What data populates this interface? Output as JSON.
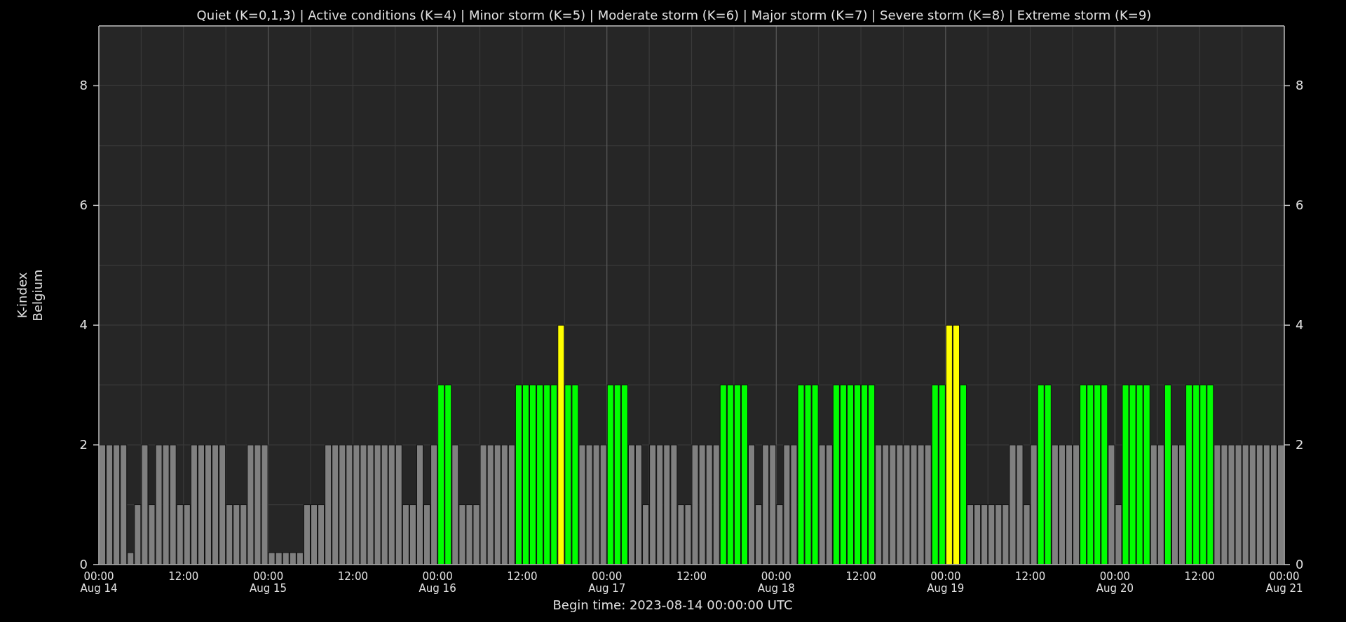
{
  "chart_data": {
    "type": "bar",
    "title": "Quiet (K=0,1,3) | Active conditions (K=4) | Minor storm (K=5) | Moderate storm (K=6) | Major storm (K=7) | Severe storm (K=8) | Extreme storm (K=9)",
    "xlabel": "Begin time: 2023-08-14 00:00:00 UTC",
    "ylabel": "K-index\nBelgium",
    "ylim": [
      0,
      9
    ],
    "yticks": [
      0,
      2,
      4,
      6,
      8
    ],
    "annotations": [
      "0",
      "2",
      "4",
      "6",
      "8",
      "00:00\nAug 21"
    ],
    "grid": true,
    "categories": [
      "00:00\nAug 14",
      null,
      null,
      null,
      null,
      null,
      null,
      null,
      null,
      null,
      null,
      null,
      "12:00",
      null,
      null,
      null,
      null,
      null,
      null,
      null,
      null,
      null,
      null,
      null,
      "00:00\nAug 15",
      null,
      null,
      null,
      null,
      null,
      null,
      null,
      null,
      null,
      null,
      null,
      "12:00",
      null,
      null,
      null,
      null,
      null,
      null,
      null,
      null,
      null,
      null,
      null,
      "00:00\nAug 16",
      null,
      null,
      null,
      null,
      null,
      null,
      null,
      null,
      null,
      null,
      null,
      "12:00",
      null,
      null,
      null,
      null,
      null,
      null,
      null,
      null,
      null,
      null,
      null,
      "00:00\nAug 17",
      null,
      null,
      null,
      null,
      null,
      null,
      null,
      null,
      null,
      null,
      null,
      "12:00",
      null,
      null,
      null,
      null,
      null,
      null,
      null,
      null,
      null,
      null,
      null,
      "00:00\nAug 18",
      null,
      null,
      null,
      null,
      null,
      null,
      null,
      null,
      null,
      null,
      null,
      "12:00",
      null,
      null,
      null,
      null,
      null,
      null,
      null,
      null,
      null,
      null,
      null,
      "00:00\nAug 19",
      null,
      null,
      null,
      null,
      null,
      null,
      null,
      null,
      null,
      null,
      null,
      "12:00",
      null,
      null,
      null,
      null,
      null,
      null,
      null,
      null,
      null,
      null,
      null,
      "00:00\nAug 20",
      null,
      null,
      null,
      null,
      null,
      null,
      null,
      null,
      null,
      null,
      null,
      "12:00",
      null,
      null,
      null,
      null,
      null,
      null,
      null,
      null,
      null,
      null,
      null
    ],
    "series": [
      {
        "color": "#808080",
        "values": [
          2,
          2,
          2,
          2,
          0.2,
          1,
          2,
          1,
          2,
          2,
          2,
          1,
          1,
          2,
          2,
          2,
          2,
          2,
          1,
          1,
          1,
          2,
          2,
          2,
          0.2,
          0.2,
          0.2,
          0.2,
          0.2,
          1,
          1,
          1,
          2,
          2,
          2,
          2,
          2,
          2,
          2,
          2,
          2,
          2,
          2,
          1,
          1,
          2,
          1,
          2,
          null,
          null,
          2,
          1,
          1,
          1,
          2,
          2,
          2,
          2,
          2,
          null,
          null,
          null,
          null,
          null,
          null,
          null,
          null,
          null,
          2,
          2,
          2,
          2,
          null,
          null,
          null,
          2,
          2,
          1,
          2,
          2,
          2,
          2,
          1,
          1,
          2,
          2,
          2,
          2,
          null,
          null,
          null,
          null,
          2,
          1,
          2,
          2,
          1,
          2,
          2,
          null,
          null,
          null,
          2,
          2,
          null,
          null,
          null,
          null,
          null,
          null,
          2,
          2,
          2,
          2,
          2,
          2,
          2,
          2,
          null,
          null,
          null,
          null,
          null,
          1,
          1,
          1,
          1,
          1,
          1,
          2,
          2,
          1,
          2,
          null,
          null,
          2,
          2,
          2,
          2,
          null,
          null,
          null,
          null,
          2,
          1,
          null,
          null,
          null,
          null,
          2,
          2,
          null,
          2,
          2,
          null,
          null,
          null,
          null,
          2,
          2,
          2,
          2,
          2,
          2,
          2,
          2,
          2,
          2
        ]
      },
      {
        "color": "#00ff00",
        "values": [
          null,
          null,
          null,
          null,
          null,
          null,
          null,
          null,
          null,
          null,
          null,
          null,
          null,
          null,
          null,
          null,
          null,
          null,
          null,
          null,
          null,
          null,
          null,
          null,
          null,
          null,
          null,
          null,
          null,
          null,
          null,
          null,
          null,
          null,
          null,
          null,
          null,
          null,
          null,
          null,
          null,
          null,
          null,
          null,
          null,
          null,
          null,
          null,
          3,
          3,
          null,
          null,
          null,
          null,
          null,
          null,
          null,
          null,
          null,
          3,
          3,
          3,
          3,
          3,
          3,
          null,
          3,
          3,
          null,
          null,
          null,
          null,
          3,
          3,
          3,
          null,
          null,
          null,
          null,
          null,
          null,
          null,
          null,
          null,
          null,
          null,
          null,
          null,
          3,
          3,
          3,
          3,
          null,
          null,
          null,
          null,
          null,
          null,
          null,
          3,
          3,
          3,
          null,
          null,
          3,
          3,
          3,
          3,
          3,
          3,
          null,
          null,
          null,
          null,
          null,
          null,
          null,
          null,
          3,
          3,
          null,
          null,
          3,
          null,
          null,
          null,
          null,
          null,
          null,
          null,
          null,
          null,
          null,
          3,
          3,
          null,
          null,
          null,
          null,
          3,
          3,
          3,
          3,
          null,
          null,
          3,
          3,
          3,
          3,
          null,
          null,
          3,
          null,
          null,
          3,
          3,
          3,
          3,
          null,
          null,
          null,
          null,
          null,
          null,
          null,
          null,
          null,
          null
        ]
      },
      {
        "color": "#ffff00",
        "values": [
          null,
          null,
          null,
          null,
          null,
          null,
          null,
          null,
          null,
          null,
          null,
          null,
          null,
          null,
          null,
          null,
          null,
          null,
          null,
          null,
          null,
          null,
          null,
          null,
          null,
          null,
          null,
          null,
          null,
          null,
          null,
          null,
          null,
          null,
          null,
          null,
          null,
          null,
          null,
          null,
          null,
          null,
          null,
          null,
          null,
          null,
          null,
          null,
          null,
          null,
          null,
          null,
          null,
          null,
          null,
          null,
          null,
          null,
          null,
          null,
          null,
          null,
          null,
          null,
          null,
          4,
          null,
          null,
          null,
          null,
          null,
          null,
          null,
          null,
          null,
          null,
          null,
          null,
          null,
          null,
          null,
          null,
          null,
          null,
          null,
          null,
          null,
          null,
          null,
          null,
          null,
          null,
          null,
          null,
          null,
          null,
          null,
          null,
          null,
          null,
          null,
          null,
          null,
          null,
          null,
          null,
          null,
          null,
          null,
          null,
          null,
          null,
          null,
          null,
          null,
          null,
          null,
          null,
          null,
          null,
          4,
          4,
          null,
          null,
          null,
          null,
          null,
          null,
          null,
          null,
          null,
          null,
          null,
          null,
          null,
          null,
          null,
          null,
          null,
          null,
          null,
          null,
          null,
          null,
          null,
          null,
          null,
          null,
          null,
          null,
          null,
          null,
          null,
          null,
          null,
          null,
          null,
          null,
          null,
          null,
          null,
          null,
          null,
          null,
          null,
          null,
          null,
          null
        ]
      }
    ]
  }
}
